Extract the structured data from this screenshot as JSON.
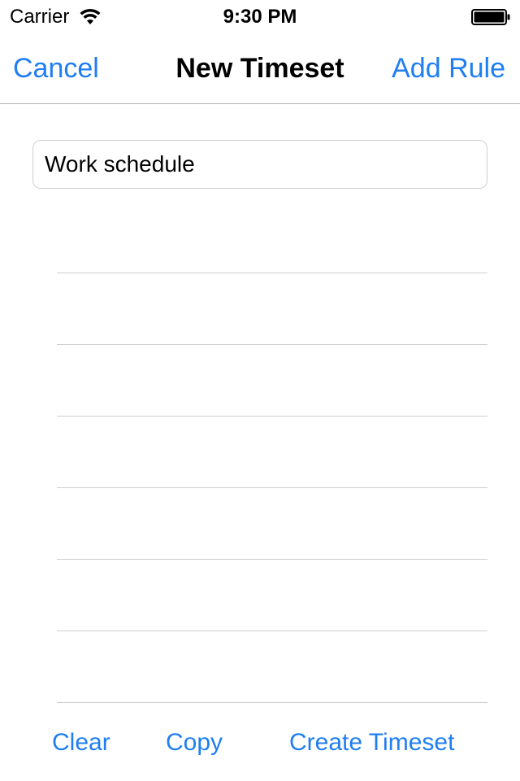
{
  "status_bar": {
    "carrier": "Carrier",
    "time": "9:30 PM",
    "wifi_icon": "wifi-icon",
    "battery_icon": "battery-icon"
  },
  "nav": {
    "cancel_label": "Cancel",
    "title": "New Timeset",
    "add_rule_label": "Add Rule"
  },
  "form": {
    "name_value": "Work schedule"
  },
  "rules": {
    "rows": [
      {},
      {},
      {},
      {},
      {},
      {},
      {}
    ]
  },
  "toolbar": {
    "clear_label": "Clear",
    "copy_label": "Copy",
    "create_label": "Create Timeset"
  },
  "colors": {
    "accent": "#1f7ef1",
    "separator": "#cfcfcf"
  }
}
